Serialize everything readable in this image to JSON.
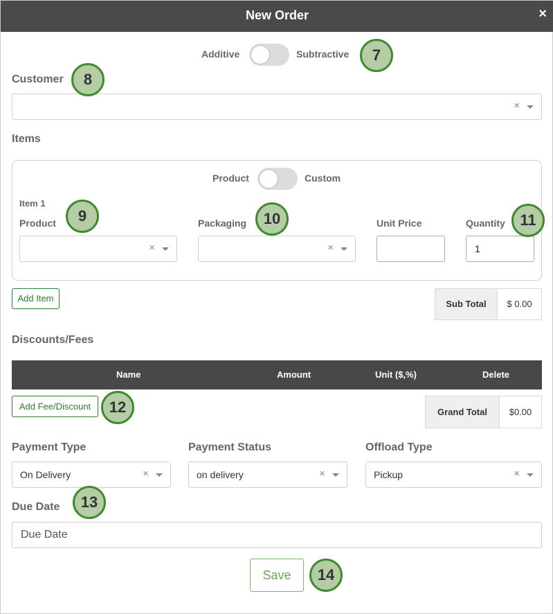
{
  "modal": {
    "title": "New Order",
    "close_icon": "×"
  },
  "mode_toggle": {
    "left_label": "Additive",
    "right_label": "Subtractive"
  },
  "customer": {
    "label": "Customer",
    "value": ""
  },
  "items": {
    "label": "Items",
    "type_toggle": {
      "left_label": "Product",
      "right_label": "Custom"
    },
    "item_title": "Item 1",
    "product_label": "Product",
    "packaging_label": "Packaging",
    "unit_price_label": "Unit Price",
    "quantity_label": "Quantity",
    "unit_price_value": "",
    "quantity_value": "1",
    "add_item_label": "Add Item"
  },
  "subtotal": {
    "label": "Sub Total",
    "value": "$ 0.00"
  },
  "fees": {
    "label": "Discounts/Fees",
    "columns": [
      "Name",
      "Amount",
      "Unit ($,%)",
      "Delete"
    ],
    "add_label": "Add Fee/Discount"
  },
  "grand_total": {
    "label": "Grand Total",
    "value": "$0.00"
  },
  "payment_type": {
    "label": "Payment Type",
    "value": "On Delivery"
  },
  "payment_status": {
    "label": "Payment Status",
    "value": "on delivery"
  },
  "offload_type": {
    "label": "Offload Type",
    "value": "Pickup"
  },
  "due_date": {
    "label": "Due Date",
    "placeholder": "Due Date"
  },
  "save_label": "Save",
  "select_clear_glyph": "×",
  "badges": [
    "7",
    "8",
    "9",
    "10",
    "11",
    "12",
    "13",
    "14"
  ],
  "colors": {
    "header_bg": "#4a4a4a",
    "accent_green": "#2e7d32",
    "badge_fill": "#b5cda5",
    "badge_border": "#3f8a2e"
  },
  "icons": {
    "close": "close-icon",
    "dropdown": "chevron-down-icon",
    "clear": "clear-icon"
  }
}
